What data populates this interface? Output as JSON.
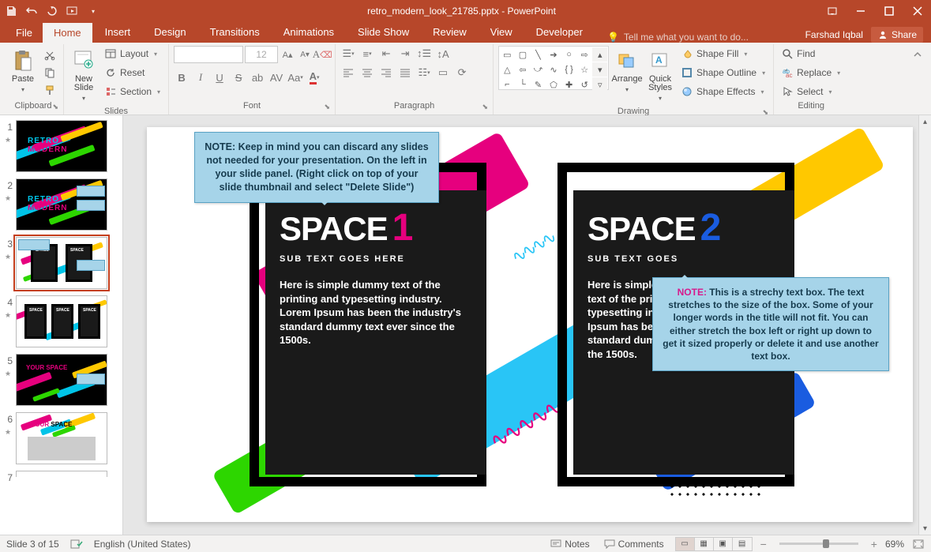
{
  "title": "retro_modern_look_21785.pptx - PowerPoint",
  "user": "Farshad Iqbal",
  "share": "Share",
  "file_tab": "File",
  "tabs": [
    "Home",
    "Insert",
    "Design",
    "Transitions",
    "Animations",
    "Slide Show",
    "Review",
    "View",
    "Developer"
  ],
  "active_tab": "Home",
  "tellme": "Tell me what you want to do...",
  "ribbon": {
    "clipboard": {
      "label": "Clipboard",
      "paste": "Paste",
      "cut": "",
      "copy": "",
      "fmt": ""
    },
    "slides": {
      "label": "Slides",
      "new": "New\nSlide",
      "layout": "Layout",
      "reset": "Reset",
      "section": "Section"
    },
    "font": {
      "label": "Font",
      "size_ph": "12"
    },
    "paragraph": {
      "label": "Paragraph"
    },
    "drawing": {
      "label": "Drawing",
      "arrange": "Arrange",
      "quick": "Quick\nStyles",
      "fill": "Shape Fill",
      "outline": "Shape Outline",
      "effects": "Shape Effects"
    },
    "editing": {
      "label": "Editing",
      "find": "Find",
      "replace": "Replace",
      "select": "Select"
    }
  },
  "thumbs_count": 7,
  "selected_thumb": 3,
  "slide": {
    "box1": {
      "title": "SPACE",
      "num": "1",
      "sub": "SUB TEXT GOES HERE",
      "body": "Here is simple dummy text of the printing and typesetting industry. Lorem Ipsum has been the industry's standard dummy text ever since the 1500s."
    },
    "box2": {
      "title": "SPACE",
      "num": "2",
      "sub": "SUB TEXT GOES",
      "body": "Here is simple du\ntext of the printin\ntypesetting indus\nIpsum has been t\nstandard dummy\nthe 1500s."
    },
    "callout_top": "NOTE: Keep in mind you can discard any slides not needed for your presentation. On the left in your slide panel. (Right click on top of your slide thumbnail and select \"Delete Slide\")",
    "callout_right_note": "NOTE:",
    "callout_right": " This is a strechy text box. The text stretches to the size of the box. Some of your longer words in the title will not fit. You can either stretch the box left or right up down to get it sized properly or delete it and use another text box."
  },
  "status": {
    "slide": "Slide 3 of 15",
    "lang": "English (United States)",
    "notes": "Notes",
    "comments": "Comments",
    "zoom": "69%"
  },
  "thumb_labels": {
    "retro": "RETRO",
    "modern": "MODERN",
    "space": "SPACE",
    "your_space": "YOUR SPACE"
  }
}
